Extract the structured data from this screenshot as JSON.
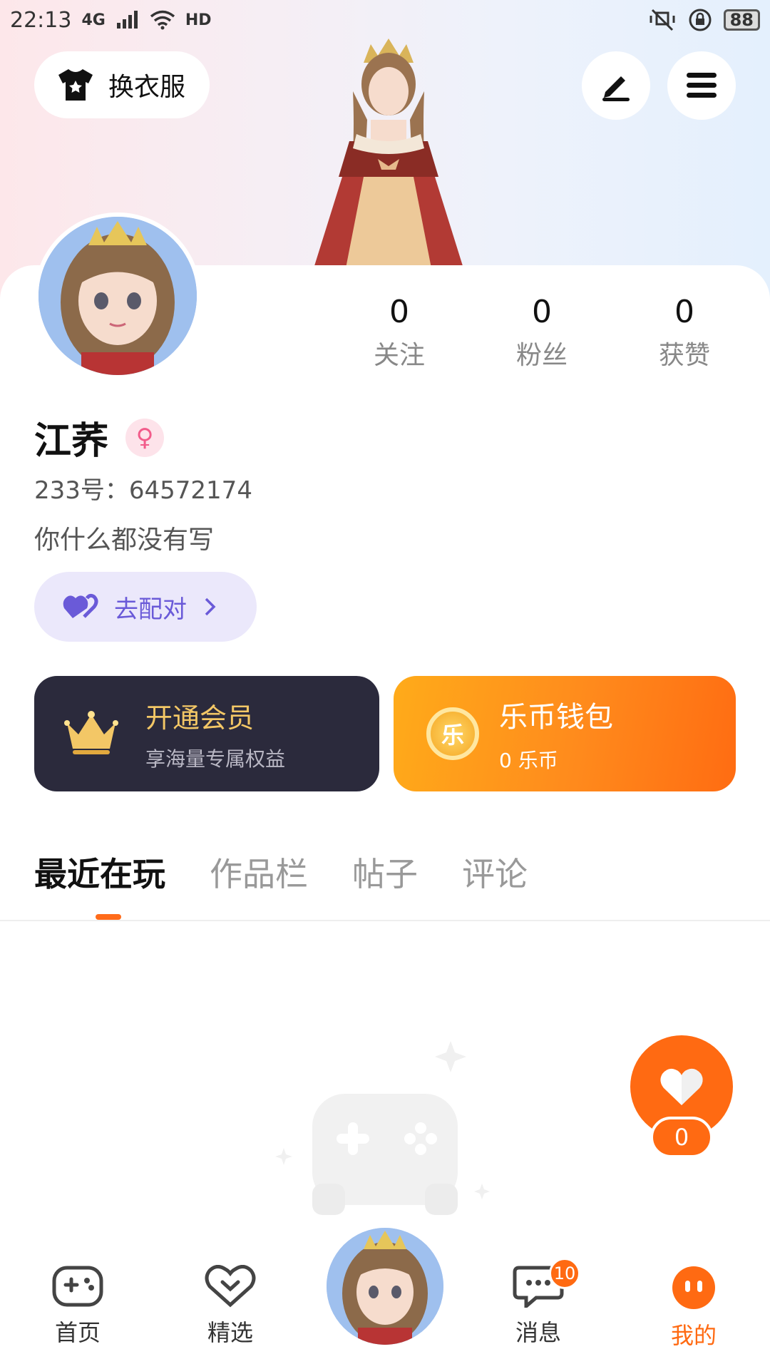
{
  "status_bar": {
    "time": "22:13",
    "network": "4G",
    "hd": "HD",
    "battery": "88"
  },
  "header": {
    "outfit_button_label": "换衣服",
    "edit_icon": "pen-icon",
    "menu_icon": "hamburger-menu-icon"
  },
  "stats": [
    {
      "value": "0",
      "label": "关注"
    },
    {
      "value": "0",
      "label": "粉丝"
    },
    {
      "value": "0",
      "label": "获赞"
    }
  ],
  "profile": {
    "name": "江荞",
    "gender_icon": "female-icon",
    "uid": "233号：64572174",
    "bio": "你什么都没有写"
  },
  "match_button": {
    "label": "去配对"
  },
  "vip_card": {
    "title": "开通会员",
    "subtitle": "享海量专属权益"
  },
  "wallet_card": {
    "title": "乐币钱包",
    "subtitle": "0 乐币",
    "coin_glyph": "乐"
  },
  "tabs": [
    {
      "label": "最近在玩",
      "active": true
    },
    {
      "label": "作品栏",
      "active": false
    },
    {
      "label": "帖子",
      "active": false
    },
    {
      "label": "评论",
      "active": false
    }
  ],
  "like_fab": {
    "count": "0"
  },
  "bottom_nav": [
    {
      "label": "首页",
      "icon": "gamepad-icon"
    },
    {
      "label": "精选",
      "icon": "heart-chevron-icon"
    },
    {
      "label": "",
      "icon": "avatar-center"
    },
    {
      "label": "消息",
      "icon": "chat-icon",
      "badge": "10"
    },
    {
      "label": "我的",
      "icon": "profile-face-icon",
      "active": true
    }
  ],
  "colors": {
    "accent": "#ff6a12",
    "vip_bg": "#2b2a3c",
    "vip_text": "#f3c766",
    "match_text": "#6a5ad8",
    "match_bg": "#ebe8fb"
  }
}
